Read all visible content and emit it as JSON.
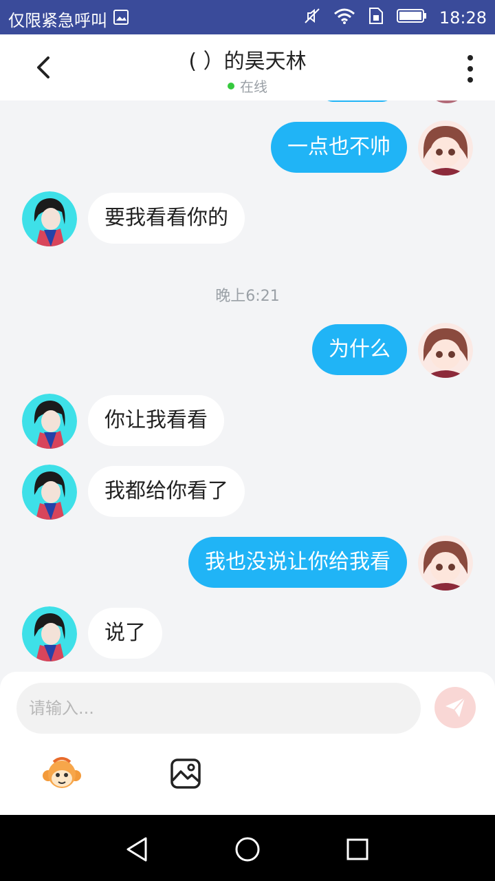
{
  "status_bar": {
    "left_text": "仅限紧急呼叫",
    "time": "18:28",
    "icons": [
      "gallery-icon",
      "mute-icon",
      "wifi-icon",
      "sim-icon",
      "battery-icon"
    ]
  },
  "header": {
    "title": "( ）的昊天林",
    "status": "在线",
    "status_color": "#36c93e"
  },
  "messages": [
    {
      "side": "me",
      "text": "一点也不帅"
    },
    {
      "side": "peer",
      "text": "要我看看你的"
    },
    {
      "type": "time",
      "text": "晚上6:21"
    },
    {
      "side": "me",
      "text": "为什么"
    },
    {
      "side": "peer",
      "text": "你让我看看"
    },
    {
      "side": "peer",
      "text": "我都给你看了"
    },
    {
      "side": "me",
      "text": "我也没说让你给我看"
    },
    {
      "side": "peer",
      "text": "说了"
    }
  ],
  "input": {
    "placeholder": "请输入..."
  },
  "colors": {
    "my_bubble": "#20b4f6",
    "peer_bubble": "#ffffff",
    "background": "#f3f4f6",
    "status_bar": "#3a4b9a",
    "send_button": "#f9d7d5"
  }
}
